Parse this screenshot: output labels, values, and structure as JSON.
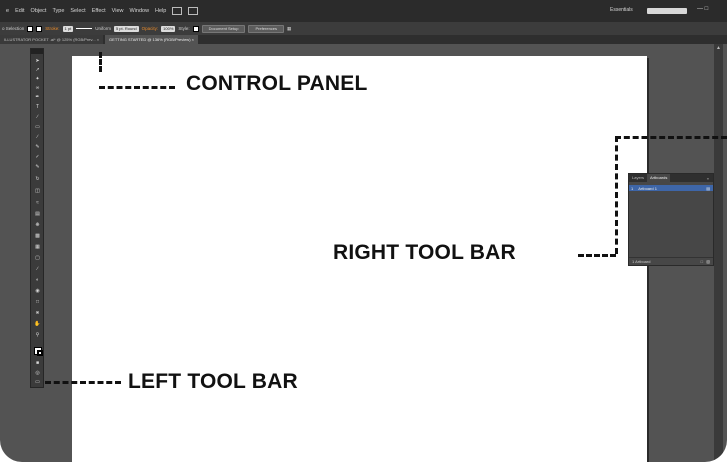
{
  "menu": {
    "items": [
      "e",
      "Edit",
      "Object",
      "Type",
      "Select",
      "Effect",
      "View",
      "Window",
      "Help"
    ],
    "workspace": "Essentials"
  },
  "control_panel": {
    "selection_label": "o Selection",
    "stroke_label": "Stroke:",
    "stroke_weight": "1 pt",
    "profile": "Uniform",
    "brush": "5 pt. Round",
    "opacity_label": "Opacity:",
    "opacity_value": "100%",
    "style_label": "Style:",
    "document_setup": "Document Setup",
    "preferences": "Preferences"
  },
  "tabs": [
    {
      "label": "ILLUSTRATOR POCKET .ai* @ 125% (RGB/Prev...",
      "close": "×"
    },
    {
      "label": "GETTING STARTED @ 136% (RGB/Preview)",
      "close": "×"
    }
  ],
  "right_panel": {
    "tabs": [
      "Layers",
      "Artboards"
    ],
    "menu_glyph": "»",
    "row_index": "1",
    "row_name": "Artboard 1",
    "footer": "1 Artboard"
  },
  "callouts": {
    "control_panel": "CONTROL PANEL",
    "right_tool_bar": "RIGHT TOOL BAR",
    "left_tool_bar": "LEFT TOOL BAR"
  },
  "icons": [
    "selection-icon",
    "direct-selection-icon",
    "magic-wand-icon",
    "lasso-icon",
    "pen-icon",
    "type-icon",
    "line-icon",
    "rectangle-icon",
    "paintbrush-icon",
    "pencil-icon",
    "blob-brush-icon",
    "eraser-icon",
    "rotate-icon",
    "scale-icon",
    "warp-icon",
    "free-transform-icon",
    "symbol-sprayer-icon",
    "graph-icon",
    "mesh-icon",
    "gradient-icon",
    "eyedropper-icon",
    "blend-icon",
    "live-paint-icon",
    "artboard-icon",
    "slice-icon",
    "hand-icon",
    "zoom-icon"
  ]
}
